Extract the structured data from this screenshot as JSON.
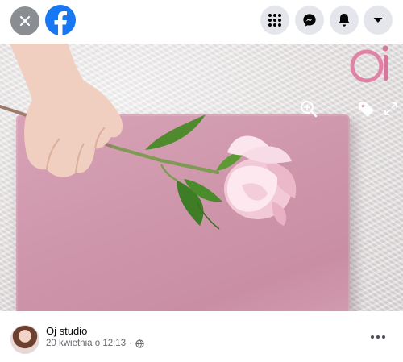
{
  "topbar": {
    "close_icon": "close-icon",
    "logo_icon": "facebook-logo-icon",
    "nav_icons": [
      "menu-grid-icon",
      "messenger-icon",
      "bell-icon",
      "chevron-down-icon"
    ]
  },
  "photo": {
    "action_icons": [
      "zoom-in-icon",
      "tag-icon",
      "fullscreen-icon"
    ]
  },
  "post": {
    "author": "Oj studio",
    "date": "20 kwietnia o 12:13",
    "separator": "·",
    "privacy_icon": "globe-icon",
    "more_icon": "more-horizontal-icon"
  },
  "colors": {
    "facebook_blue": "#1877f2",
    "nav_button_bg": "#e4e6eb",
    "close_bg": "#8a8d91",
    "board_pink": "#cf97ac"
  }
}
